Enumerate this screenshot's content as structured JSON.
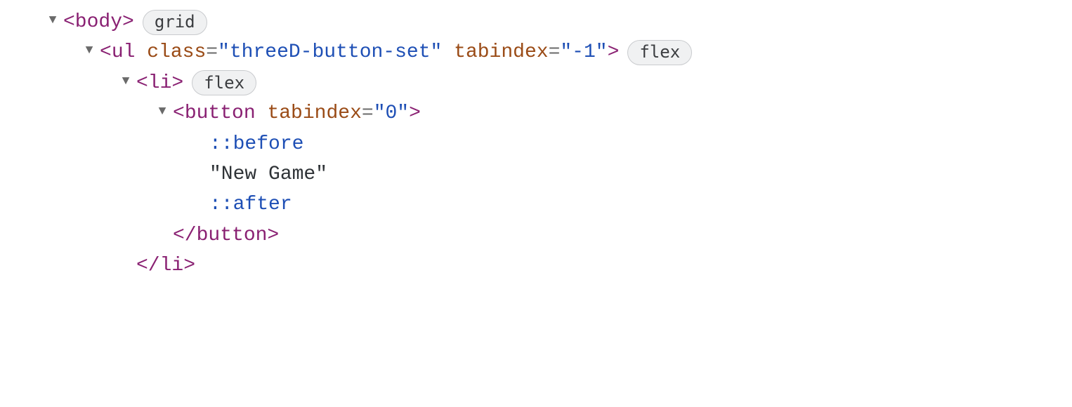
{
  "tree": {
    "row0": {
      "tag_open": "<body>",
      "badge": "grid"
    },
    "row1": {
      "tag_open_lt": "<",
      "tag_name": "ul",
      "attr1_name": "class",
      "attr1_eq": "=",
      "attr1_val": "\"threeD-button-set\"",
      "attr2_name": "tabindex",
      "attr2_eq": "=",
      "attr2_val": "\"-1\"",
      "tag_open_gt": ">",
      "badge": "flex"
    },
    "row2": {
      "tag_open": "<li>",
      "badge": "flex"
    },
    "row3": {
      "tag_open_lt": "<",
      "tag_name": "button",
      "attr1_name": "tabindex",
      "attr1_eq": "=",
      "attr1_val": "\"0\"",
      "tag_open_gt": ">"
    },
    "row4": {
      "pseudo": "::before"
    },
    "row5": {
      "text": "\"New Game\""
    },
    "row6": {
      "pseudo": "::after"
    },
    "row7": {
      "tag_close": "</button>"
    },
    "row8": {
      "tag_close": "</li>"
    }
  }
}
